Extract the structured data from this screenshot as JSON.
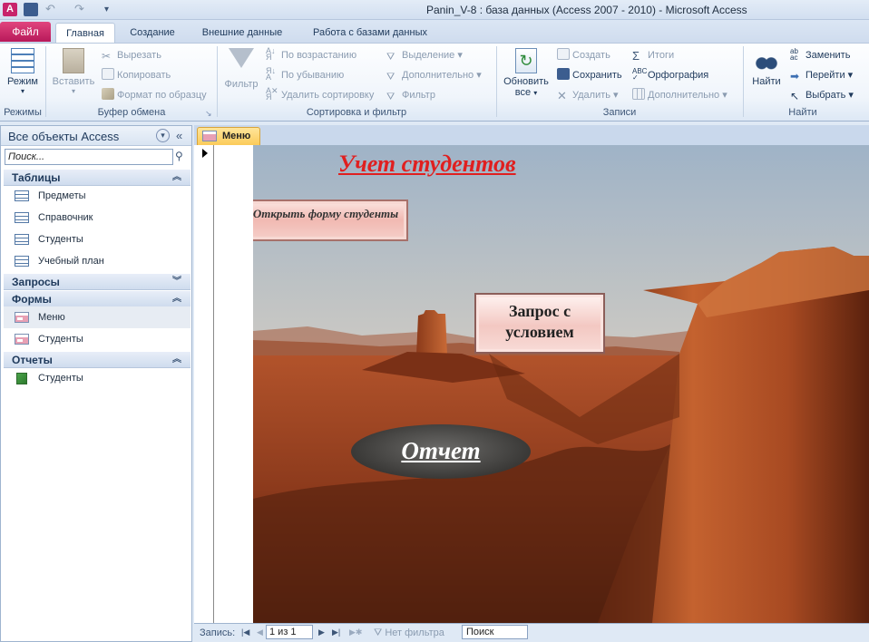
{
  "window": {
    "title": "Panin_V-8 : база данных (Access 2007 - 2010)  -  Microsoft Access"
  },
  "ribbon_tabs": [
    "Файл",
    "Главная",
    "Создание",
    "Внешние данные",
    "Работа с базами данных"
  ],
  "ribbon": {
    "modes": {
      "view_label": "Режим",
      "group": "Режимы"
    },
    "clipboard": {
      "paste_label": "Вставить",
      "cut": "Вырезать",
      "copy": "Копировать",
      "format_painter": "Формат по образцу",
      "group": "Буфер обмена"
    },
    "sort_filter": {
      "filter_label": "Фильтр",
      "asc": "По возрастанию",
      "desc": "По убыванию",
      "remove_sort": "Удалить сортировку",
      "selection": "Выделение",
      "advanced": "Дополнительно",
      "toggle_filter": "Фильтр",
      "group": "Сортировка и фильтр"
    },
    "records": {
      "refresh_line1": "Обновить",
      "refresh_line2": "все",
      "new": "Создать",
      "save": "Сохранить",
      "delete": "Удалить",
      "totals": "Итоги",
      "spelling": "Орфография",
      "more": "Дополнительно",
      "group": "Записи"
    },
    "find": {
      "find_label": "Найти",
      "replace": "Заменить",
      "goto": "Перейти",
      "select": "Выбрать",
      "group": "Найти"
    }
  },
  "nav_pane": {
    "title": "Все объекты Access",
    "search_placeholder": "Поиск...",
    "sections": [
      {
        "label": "Таблицы",
        "items": [
          "Предметы",
          "Справочник",
          "Студенты",
          "Учебный план"
        ]
      },
      {
        "label": "Запросы",
        "items": []
      },
      {
        "label": "Формы",
        "items": [
          "Меню",
          "Студенты"
        ]
      },
      {
        "label": "Отчеты",
        "items": [
          "Студенты"
        ]
      }
    ]
  },
  "document": {
    "tab_label": "Меню",
    "form_title": "Учет студентов",
    "button_open_form": "Открыть форму студенты",
    "button_query": "Запрос с условием",
    "button_report": "Отчет"
  },
  "record_nav": {
    "label": "Запись:",
    "position": "1 из 1",
    "filter_status": "Нет фильтра",
    "search": "Поиск"
  },
  "colors": {
    "file_tab": "#c8246b",
    "form_title": "#e01f1f",
    "doc_tab": "#fbcb5a"
  }
}
